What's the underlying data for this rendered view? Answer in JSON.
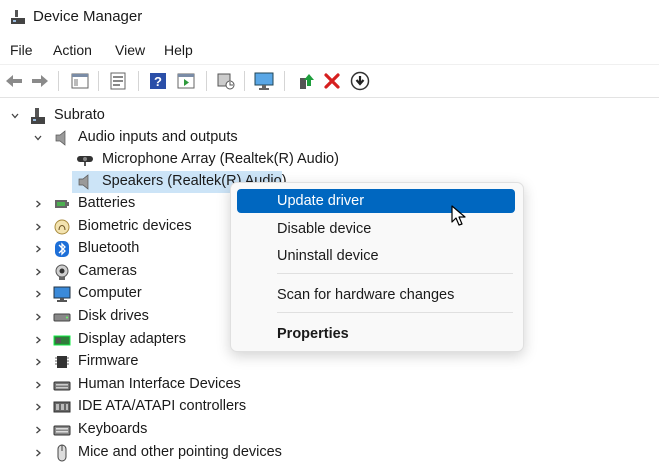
{
  "window": {
    "title": "Device Manager"
  },
  "menu": [
    "File",
    "Action",
    "View",
    "Help"
  ],
  "toolbar": {
    "buttons": [
      "back-arrow-icon",
      "forward-arrow-icon",
      "show-hide-console-tree-icon",
      "properties-icon",
      "help-icon",
      "action-pane-icon",
      "scan-hardware-icon",
      "monitor-icon",
      "update-driver-icon",
      "uninstall-x-icon",
      "download-circle-icon"
    ],
    "accent_red": "#d61f1f",
    "accent_green": "#1e9e3c"
  },
  "tree": {
    "root": "Subrato",
    "audio": {
      "label": "Audio inputs and outputs",
      "children": [
        "Microphone Array (Realtek(R) Audio)",
        "Speakers (Realtek(R) Audio)"
      ]
    },
    "categories": [
      "Batteries",
      "Biometric devices",
      "Bluetooth",
      "Cameras",
      "Computer",
      "Disk drives",
      "Display adapters",
      "Firmware",
      "Human Interface Devices",
      "IDE ATA/ATAPI controllers",
      "Keyboards",
      "Mice and other pointing devices"
    ]
  },
  "context_menu": {
    "items": [
      "Update driver",
      "Disable device",
      "Uninstall device",
      "Scan for hardware changes",
      "Properties"
    ],
    "active_color": "#0067c0"
  }
}
